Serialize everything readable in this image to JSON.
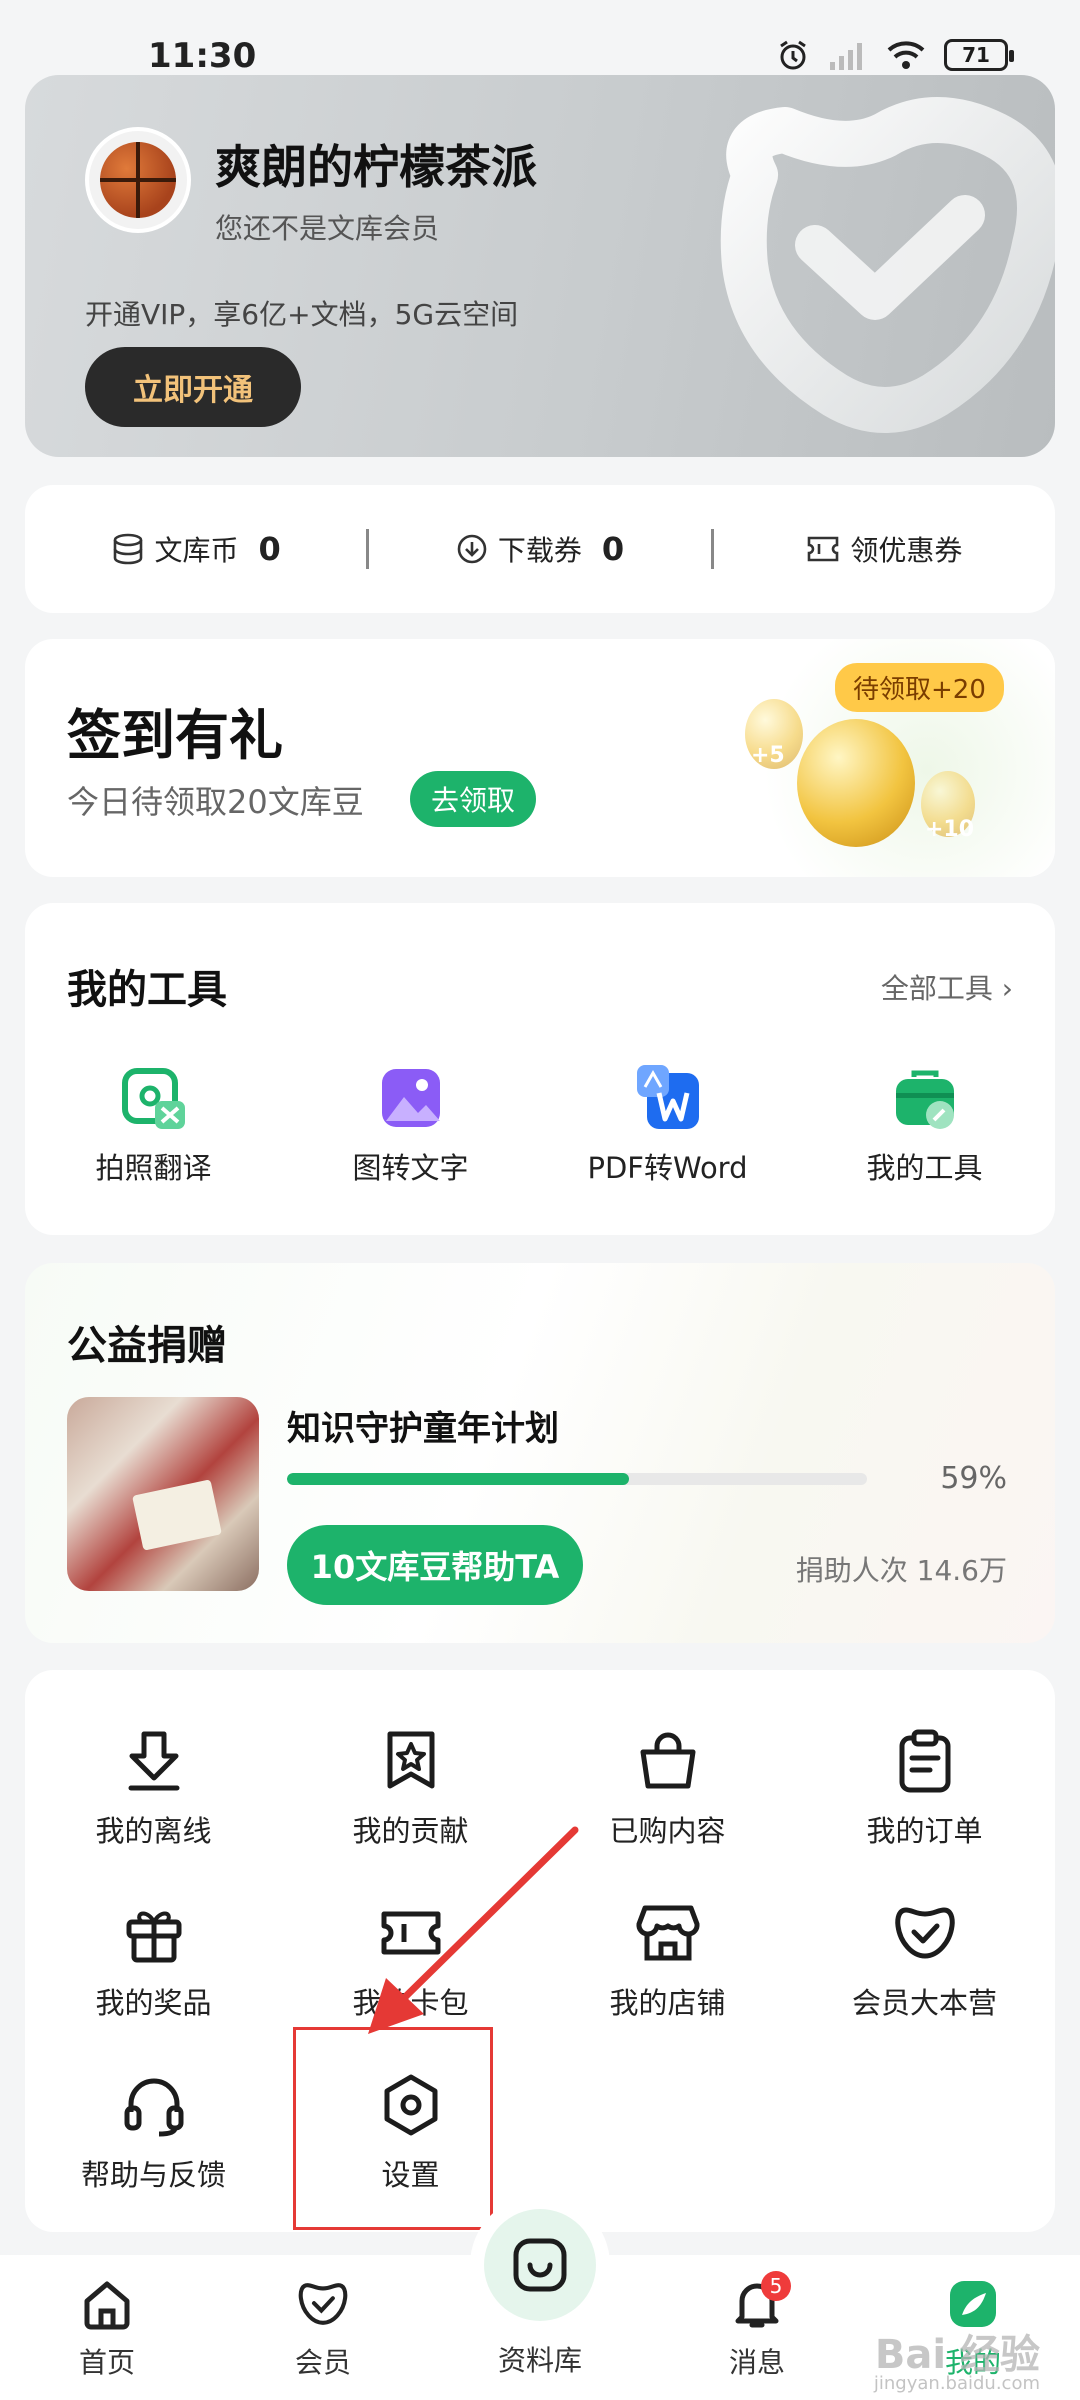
{
  "status_bar": {
    "time": "11:30",
    "battery": "71"
  },
  "profile": {
    "username": "爽朗的柠檬茶派",
    "member_status": "您还不是文库会员",
    "vip_promo": "开通VIP，享6亿+文档，5G云空间",
    "vip_button": "立即开通"
  },
  "assets": [
    {
      "label": "文库币",
      "value": "0",
      "icon": "coin-stack-icon"
    },
    {
      "label": "下载券",
      "value": "0",
      "icon": "download-circle-icon"
    },
    {
      "label": "领优惠券",
      "value": "",
      "icon": "ticket-icon"
    }
  ],
  "checkin": {
    "title": "签到有礼",
    "subtitle": "今日待领取20文库豆",
    "button": "去领取",
    "badge": "待领取+20",
    "bean_left_label": "+5",
    "bean_right_label": "+10"
  },
  "tools": {
    "title": "我的工具",
    "all_link": "全部工具 ›",
    "items": [
      {
        "label": "拍照翻译",
        "icon": "photo-translate-icon",
        "color": "#1db36b"
      },
      {
        "label": "图转文字",
        "icon": "image-to-text-icon",
        "color": "#8b5cf6"
      },
      {
        "label": "PDF转Word",
        "icon": "pdf-to-word-icon",
        "color": "#1e6cf0"
      },
      {
        "label": "我的工具",
        "icon": "toolbox-icon",
        "color": "#1db36b"
      }
    ]
  },
  "charity": {
    "title": "公益捐赠",
    "project": "知识守护童年计划",
    "progress": 0.59,
    "progress_label": "59%",
    "button": "10文库豆帮助TA",
    "donor_count": "捐助人次 14.6万"
  },
  "services": [
    {
      "label": "我的离线",
      "icon": "offline-download-icon"
    },
    {
      "label": "我的贡献",
      "icon": "contribution-icon"
    },
    {
      "label": "已购内容",
      "icon": "shopping-bag-icon"
    },
    {
      "label": "我的订单",
      "icon": "order-clipboard-icon"
    },
    {
      "label": "我的奖品",
      "icon": "gift-icon"
    },
    {
      "label": "我的卡包",
      "icon": "card-wallet-icon"
    },
    {
      "label": "我的店铺",
      "icon": "store-icon"
    },
    {
      "label": "会员大本营",
      "icon": "member-camp-icon"
    },
    {
      "label": "帮助与反馈",
      "icon": "headset-icon"
    },
    {
      "label": "设置",
      "icon": "settings-hexagon-icon"
    }
  ],
  "bottom_nav": [
    {
      "label": "首页",
      "icon": "home-icon"
    },
    {
      "label": "会员",
      "icon": "member-icon"
    },
    {
      "label": "资料库",
      "icon": "library-icon"
    },
    {
      "label": "消息",
      "icon": "bell-icon",
      "badge": "5"
    },
    {
      "label": "我的",
      "icon": "profile-leaf-icon"
    }
  ],
  "watermark": {
    "text": "Bai 经验",
    "sub": "jingyan.baidu.com"
  },
  "colors": {
    "accent": "#1db36b",
    "vip_text": "#f2c27a",
    "highlight": "#e53935"
  }
}
